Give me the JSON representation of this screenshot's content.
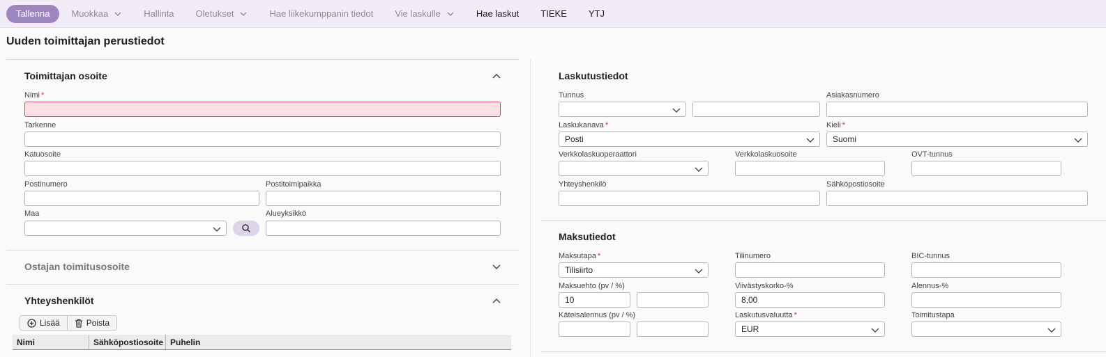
{
  "toolbar": {
    "save_label": "Tallenna",
    "edit_label": "Muokkaa",
    "admin_label": "Hallinta",
    "defaults_label": "Oletukset",
    "partner_label": "Hae liikekumppanin tiedot",
    "export_label": "Vie laskulle",
    "invoices_label": "Hae laskut",
    "tieke_label": "TIEKE",
    "ytj_label": "YTJ"
  },
  "page_title": "Uuden toimittajan perustiedot",
  "address": {
    "title": "Toimittajan osoite",
    "name_label": "Nimi",
    "name_value": "",
    "extra_label": "Tarkenne",
    "street_label": "Katuosoite",
    "postcode_label": "Postinumero",
    "city_label": "Postitoimipaikka",
    "country_label": "Maa",
    "region_label": "Alueyksikkö"
  },
  "delivery": {
    "title": "Ostajan toimitusosoite"
  },
  "contacts": {
    "title": "Yhteyshenkilöt",
    "add_label": "Lisää",
    "delete_label": "Poista",
    "columns": [
      "Nimi",
      "Sähköpostiosoite",
      "Puhelin"
    ]
  },
  "billing": {
    "title": "Laskutustiedot",
    "id_label": "Tunnus",
    "customer_no_label": "Asiakasnumero",
    "channel_label": "Laskukanava",
    "channel_value": "Posti",
    "language_label": "Kieli",
    "language_value": "Suomi",
    "operator_label": "Verkkolaskuoperaattori",
    "einvoice_address_label": "Verkkolaskuosoite",
    "ovt_label": "OVT-tunnus",
    "contact_person_label": "Yhteyshenkilö",
    "email_label": "Sähköpostiosoite"
  },
  "payment": {
    "title": "Maksutiedot",
    "method_label": "Maksutapa",
    "method_value": "Tilisiirto",
    "account_label": "Tilinumero",
    "bic_label": "BIC-tunnus",
    "terms_label": "Maksuehto (pv / %)",
    "terms_days": "10",
    "interest_label": "Viivästyskorko-%",
    "interest_value": "8,00",
    "discount_label": "Alennus-%",
    "cash_discount_label": "Käteisalennus (pv / %)",
    "currency_label": "Laskutusvaluutta",
    "currency_value": "EUR",
    "delivery_method_label": "Toimitustapa"
  },
  "required_mark": "*",
  "colors": {
    "accent": "#9e86bf",
    "toolbar_bg": "#f1ecf7",
    "error_bg": "#fde0e6",
    "error_border": "#d9485c"
  }
}
